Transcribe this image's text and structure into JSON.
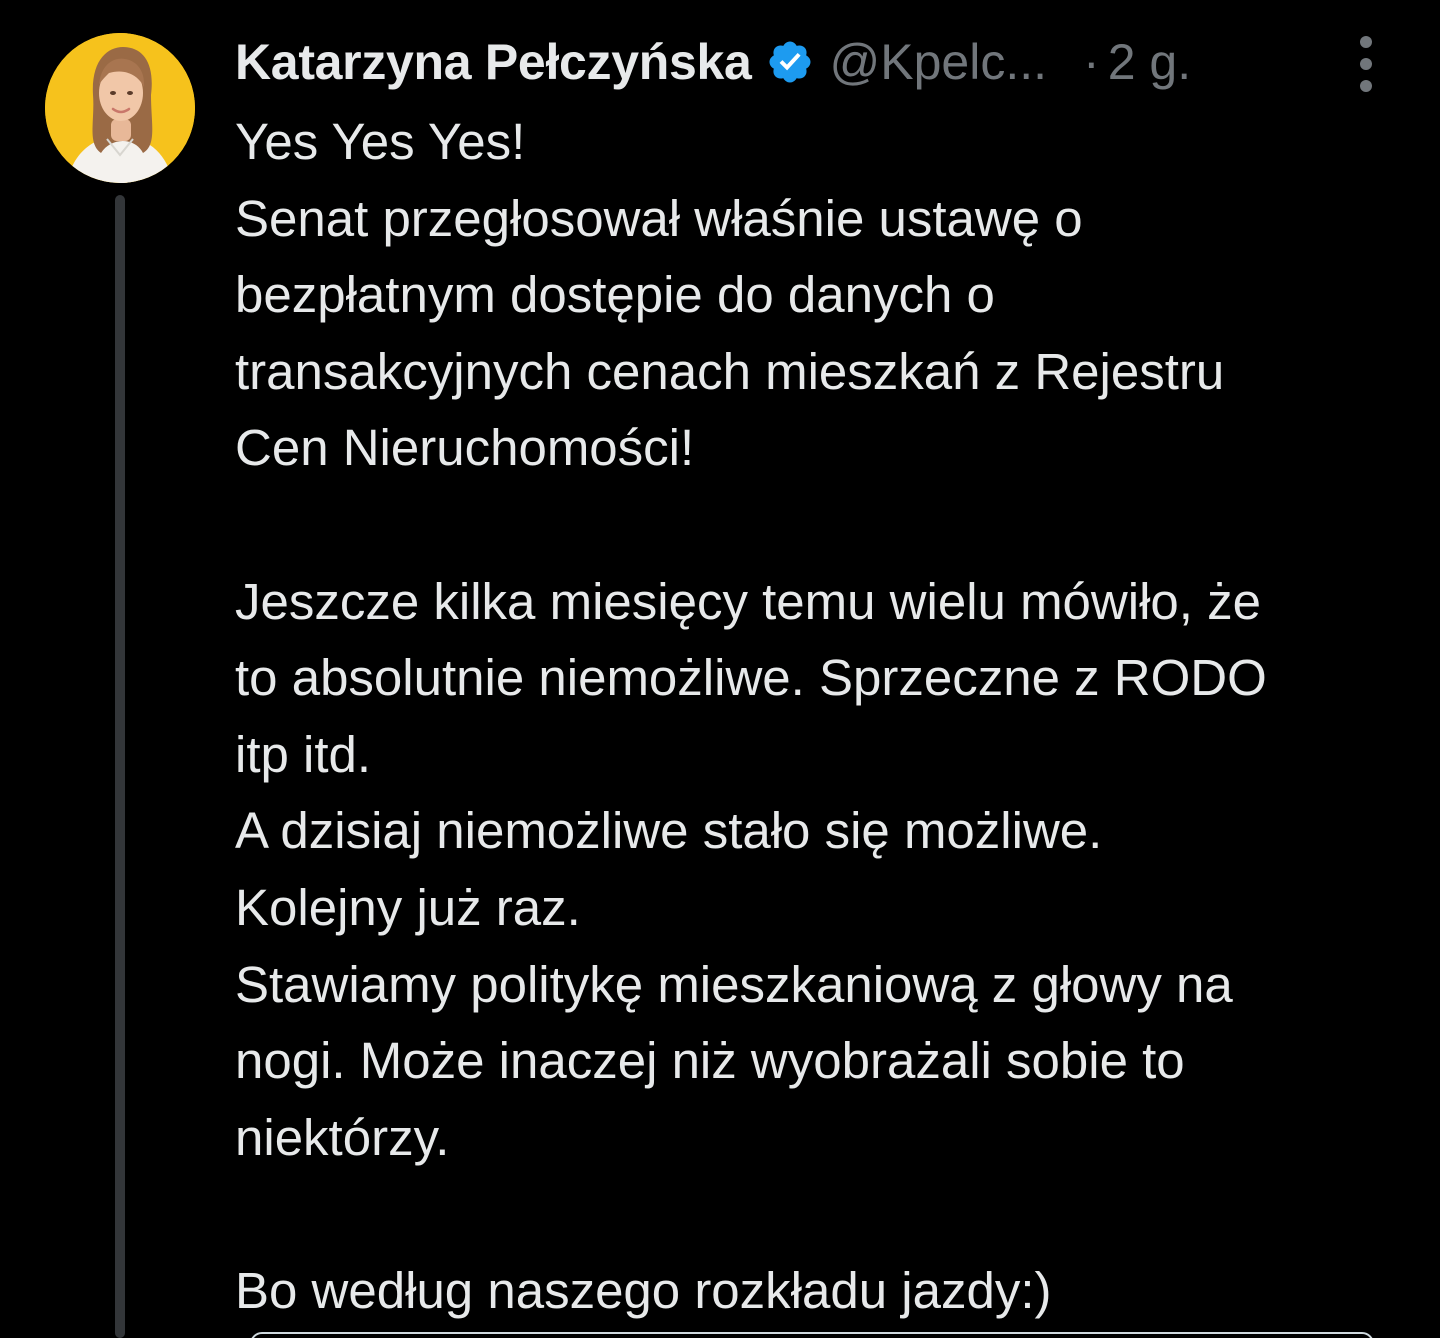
{
  "tweet": {
    "author": {
      "display_name": "Katarzyna Pełczyńska",
      "handle": "@Kpelc...",
      "verified": true
    },
    "separator": "·",
    "timestamp": "2 g.",
    "icons": {
      "avatar": "avatar-photo",
      "verified": "verified-badge-icon",
      "more": "more-options-icon"
    },
    "colors": {
      "background": "#000000",
      "text": "#e7e9ea",
      "secondary_text": "#71767b",
      "verified_badge": "#1d9bf0",
      "thread_line": "#333639",
      "avatar_background": "#f6c21c"
    },
    "text_lines": [
      "Yes Yes Yes!",
      "Senat przegłosował właśnie ustawę o",
      "bezpłatnym dostępie do danych o",
      "transakcyjnych cenach mieszkań z Rejestru",
      "Cen Nieruchomości!",
      "",
      "Jeszcze kilka miesięcy temu wielu mówiło, że",
      "to absolutnie niemożliwe. Sprzeczne z RODO",
      "itp itd.",
      "A dzisiaj niemożliwe stało się możliwe.",
      "Kolejny już raz.",
      "Stawiamy politykę mieszkaniową z głowy na",
      "nogi. Może inaczej niż wyobrażali sobie to",
      "niektórzy.",
      "",
      "Bo według naszego rozkładu jazdy:)"
    ]
  }
}
